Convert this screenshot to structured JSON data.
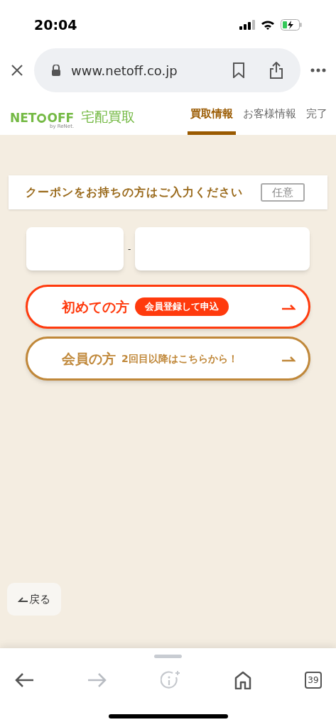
{
  "status_bar": {
    "time": "20:04"
  },
  "browser": {
    "url": "www.netoff.co.jp"
  },
  "header": {
    "logo": {
      "left": "NET",
      "right": "OFF",
      "sub": "by ReNet."
    },
    "service": "宅配買取",
    "steps": [
      {
        "label": "買取情報",
        "selected": true
      },
      {
        "label": "お客様情報",
        "selected": false
      },
      {
        "label": "完了",
        "selected": false
      }
    ]
  },
  "coupon": {
    "title": "クーポンをお持ちの方はご入力ください",
    "badge": "任意",
    "separator": "-"
  },
  "actions": [
    {
      "kind": "new",
      "label": "初めての方",
      "tag": "会員登録して申込"
    },
    {
      "kind": "member",
      "label": "会員の方",
      "tag": "2回目以降はこちらから！"
    }
  ],
  "back_button": "戻る",
  "toolbar": {
    "forward_disabled": true,
    "tab_count": "39"
  }
}
